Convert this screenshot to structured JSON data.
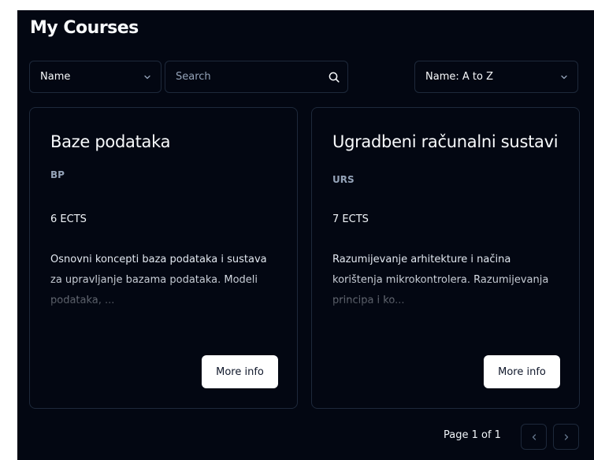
{
  "page": {
    "title": "My Courses"
  },
  "filters": {
    "field_select": {
      "value": "Name",
      "icon": "chevron-down-icon"
    },
    "search": {
      "placeholder": "Search",
      "value": "",
      "icon": "search-icon"
    },
    "sort_select": {
      "value": "Name: A to Z",
      "icon": "chevron-down-icon"
    }
  },
  "courses": [
    {
      "title": "Baze podataka",
      "code": "BP",
      "ects": "6 ECTS",
      "description": "Osnovni koncepti baza podataka i sustava za upravljanje bazama podataka. Modeli podataka, ...",
      "button_label": "More info"
    },
    {
      "title": "Ugradbeni računalni sustavi",
      "code": "URS",
      "ects": "7 ECTS",
      "description": "Razumijevanje arhitekture i načina korištenja mikrokontrolera. Razumijevanja principa i ko...",
      "button_label": "More info"
    }
  ],
  "pagination": {
    "label": "Page 1 of 1",
    "prev_icon": "chevron-left-icon",
    "next_icon": "chevron-right-icon"
  },
  "colors": {
    "background": "#030712",
    "border": "#1e293b",
    "text": "#f8fafc",
    "muted": "#94a3b8",
    "button_bg": "#ffffff",
    "button_text": "#0f172a"
  }
}
